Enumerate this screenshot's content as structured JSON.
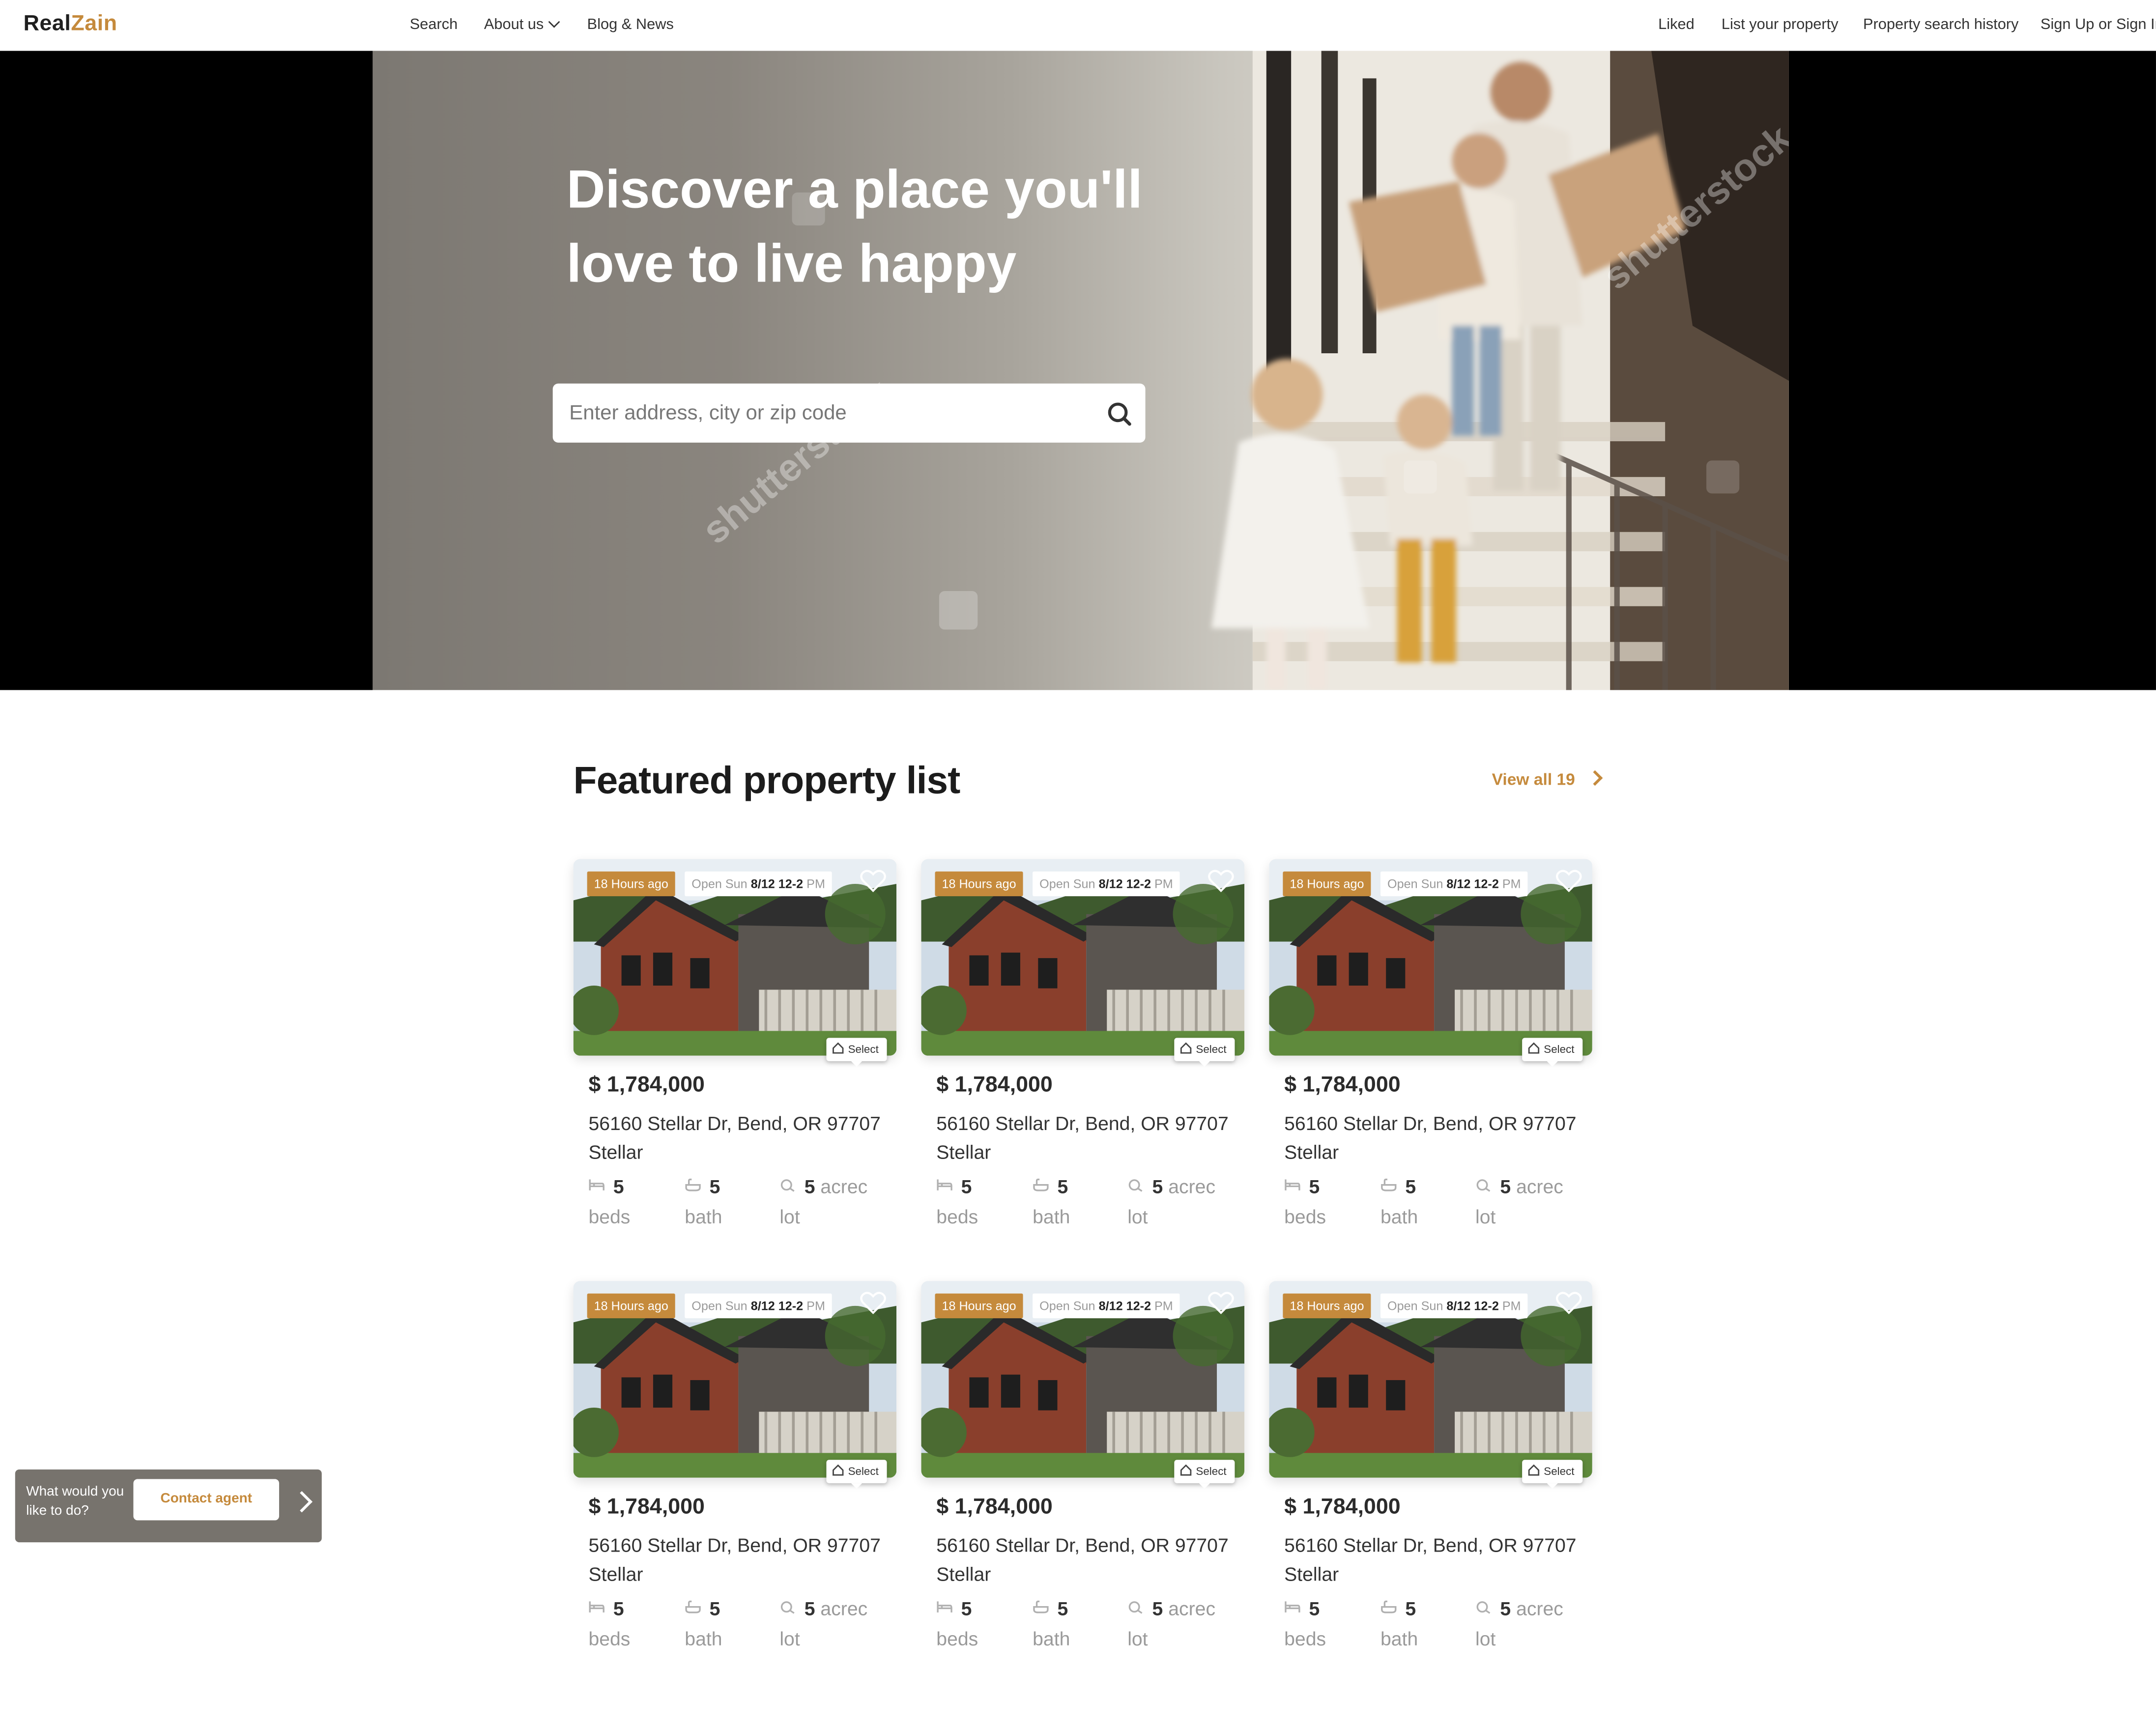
{
  "header": {
    "logo_part1": "Real",
    "logo_part2": "Zain",
    "nav_left": [
      "Search",
      "About us",
      "Blog & News"
    ],
    "nav_right": [
      "Liked",
      "List your property",
      "Property search history",
      "Sign Up or Sign In"
    ]
  },
  "hero": {
    "title_line1": "Discover a place you'll",
    "title_line2": "love to live happy",
    "search_placeholder": "Enter address, city or zip code",
    "watermark_text": "shutterstock"
  },
  "featured": {
    "title": "Featured property list",
    "view_all": "View all 19"
  },
  "listings": [
    {
      "time": "18 Hours ago",
      "open_prefix": "Open Sun",
      "open_date": "8/12 12-2",
      "open_suffix": "PM",
      "select": "Select",
      "price": "$ 1,784,000",
      "address": "56160 Stellar Dr, Bend, OR 97707 Stellar",
      "beds": "5",
      "beds_unit": "beds",
      "bath": "5",
      "bath_unit": "bath",
      "lot": "5",
      "lot_unit_a": "acrec",
      "lot_unit_b": "lot"
    },
    {
      "time": "18 Hours ago",
      "open_prefix": "Open Sun",
      "open_date": "8/12 12-2",
      "open_suffix": "PM",
      "select": "Select",
      "price": "$ 1,784,000",
      "address": "56160 Stellar Dr, Bend, OR 97707 Stellar",
      "beds": "5",
      "beds_unit": "beds",
      "bath": "5",
      "bath_unit": "bath",
      "lot": "5",
      "lot_unit_a": "acrec",
      "lot_unit_b": "lot"
    },
    {
      "time": "18 Hours ago",
      "open_prefix": "Open Sun",
      "open_date": "8/12 12-2",
      "open_suffix": "PM",
      "select": "Select",
      "price": "$ 1,784,000",
      "address": "56160 Stellar Dr, Bend, OR 97707 Stellar",
      "beds": "5",
      "beds_unit": "beds",
      "bath": "5",
      "bath_unit": "bath",
      "lot": "5",
      "lot_unit_a": "acrec",
      "lot_unit_b": "lot"
    },
    {
      "time": "18 Hours ago",
      "open_prefix": "Open Sun",
      "open_date": "8/12 12-2",
      "open_suffix": "PM",
      "select": "Select",
      "price": "$ 1,784,000",
      "address": "56160 Stellar Dr, Bend, OR 97707 Stellar",
      "beds": "5",
      "beds_unit": "beds",
      "bath": "5",
      "bath_unit": "bath",
      "lot": "5",
      "lot_unit_a": "acrec",
      "lot_unit_b": "lot"
    },
    {
      "time": "18 Hours ago",
      "open_prefix": "Open Sun",
      "open_date": "8/12 12-2",
      "open_suffix": "PM",
      "select": "Select",
      "price": "$ 1,784,000",
      "address": "56160 Stellar Dr, Bend, OR 97707 Stellar",
      "beds": "5",
      "beds_unit": "beds",
      "bath": "5",
      "bath_unit": "bath",
      "lot": "5",
      "lot_unit_a": "acrec",
      "lot_unit_b": "lot"
    },
    {
      "time": "18 Hours ago",
      "open_prefix": "Open Sun",
      "open_date": "8/12 12-2",
      "open_suffix": "PM",
      "select": "Select",
      "price": "$ 1,784,000",
      "address": "56160 Stellar Dr, Bend, OR 97707 Stellar",
      "beds": "5",
      "beds_unit": "beds",
      "bath": "5",
      "bath_unit": "bath",
      "lot": "5",
      "lot_unit_a": "acrec",
      "lot_unit_b": "lot"
    }
  ],
  "contact_widget": {
    "question": "What would you like to do?",
    "button": "Contact agent"
  },
  "colors": {
    "accent": "#c58a3c",
    "text_dark": "#2b2b2b",
    "muted": "#9a9a9a",
    "widget_bg": "#77736d"
  },
  "icons": [
    "chevron-down-icon",
    "search-icon",
    "heart-icon",
    "home-icon",
    "bed-icon",
    "bath-icon",
    "lot-icon",
    "chevron-right-icon"
  ]
}
